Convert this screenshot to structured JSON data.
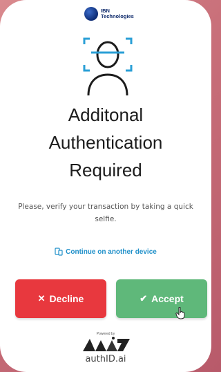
{
  "brand": {
    "line1": "IBN",
    "line2": "Technologies"
  },
  "title_lines": [
    "Additonal",
    "Authentication",
    "Required"
  ],
  "description": "Please, verify your transaction by taking a quick selfie.",
  "continue_link": "Continue on another device",
  "buttons": {
    "decline": "Decline",
    "accept": "Accept"
  },
  "footer": {
    "powered_by": "Powered by",
    "product": "authID.ai"
  },
  "colors": {
    "accent": "#1e8fc9",
    "decline": "#e8383e",
    "accept": "#5fb87a"
  }
}
